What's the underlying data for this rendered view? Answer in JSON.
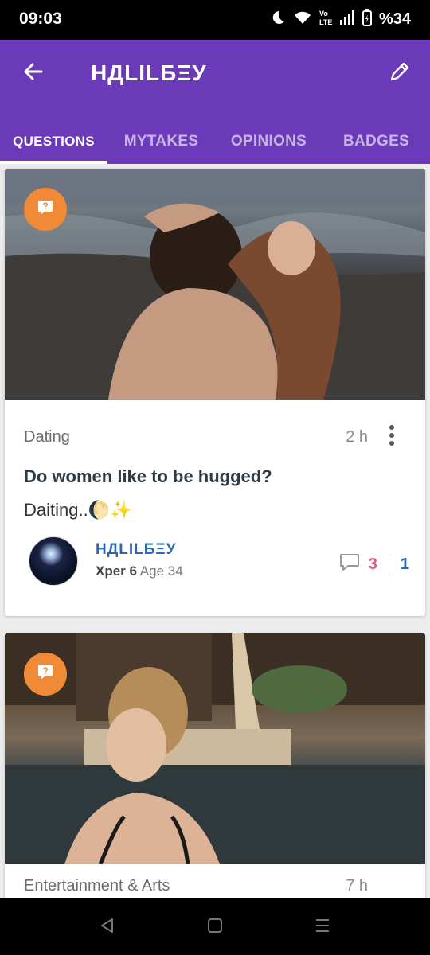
{
  "status_bar": {
    "time": "09:03",
    "battery_text": "%34",
    "icons": [
      "moon-icon",
      "wifi-icon",
      "volte-icon",
      "signal-icon",
      "battery-icon"
    ]
  },
  "app_bar": {
    "title": "НДLILБΞУ",
    "back_icon": "arrow-left-icon",
    "edit_icon": "pencil-icon",
    "background": "#6b3ab8"
  },
  "tabs": [
    {
      "label": "QUESTIONS",
      "active": true
    },
    {
      "label": "MYTAKES",
      "active": false
    },
    {
      "label": "OPINIONS",
      "active": false
    },
    {
      "label": "BADGES",
      "active": false
    }
  ],
  "cards": [
    {
      "badge_icon": "question-icon",
      "category": "Dating",
      "time": "2 h",
      "title": "Do women like to be hugged?",
      "description": "Daiting..🌔✨",
      "author": {
        "name": "НДLILБΞУ",
        "xper": "Xper 6",
        "age": "Age 34"
      },
      "comments": "3",
      "votes": "1"
    },
    {
      "badge_icon": "question-icon",
      "category": "Entertainment & Arts",
      "time": "7 h"
    }
  ],
  "colors": {
    "accent": "#6b3ab8",
    "badge": "#f08a36",
    "link": "#2b69b8",
    "comment": "#e05a8a"
  }
}
